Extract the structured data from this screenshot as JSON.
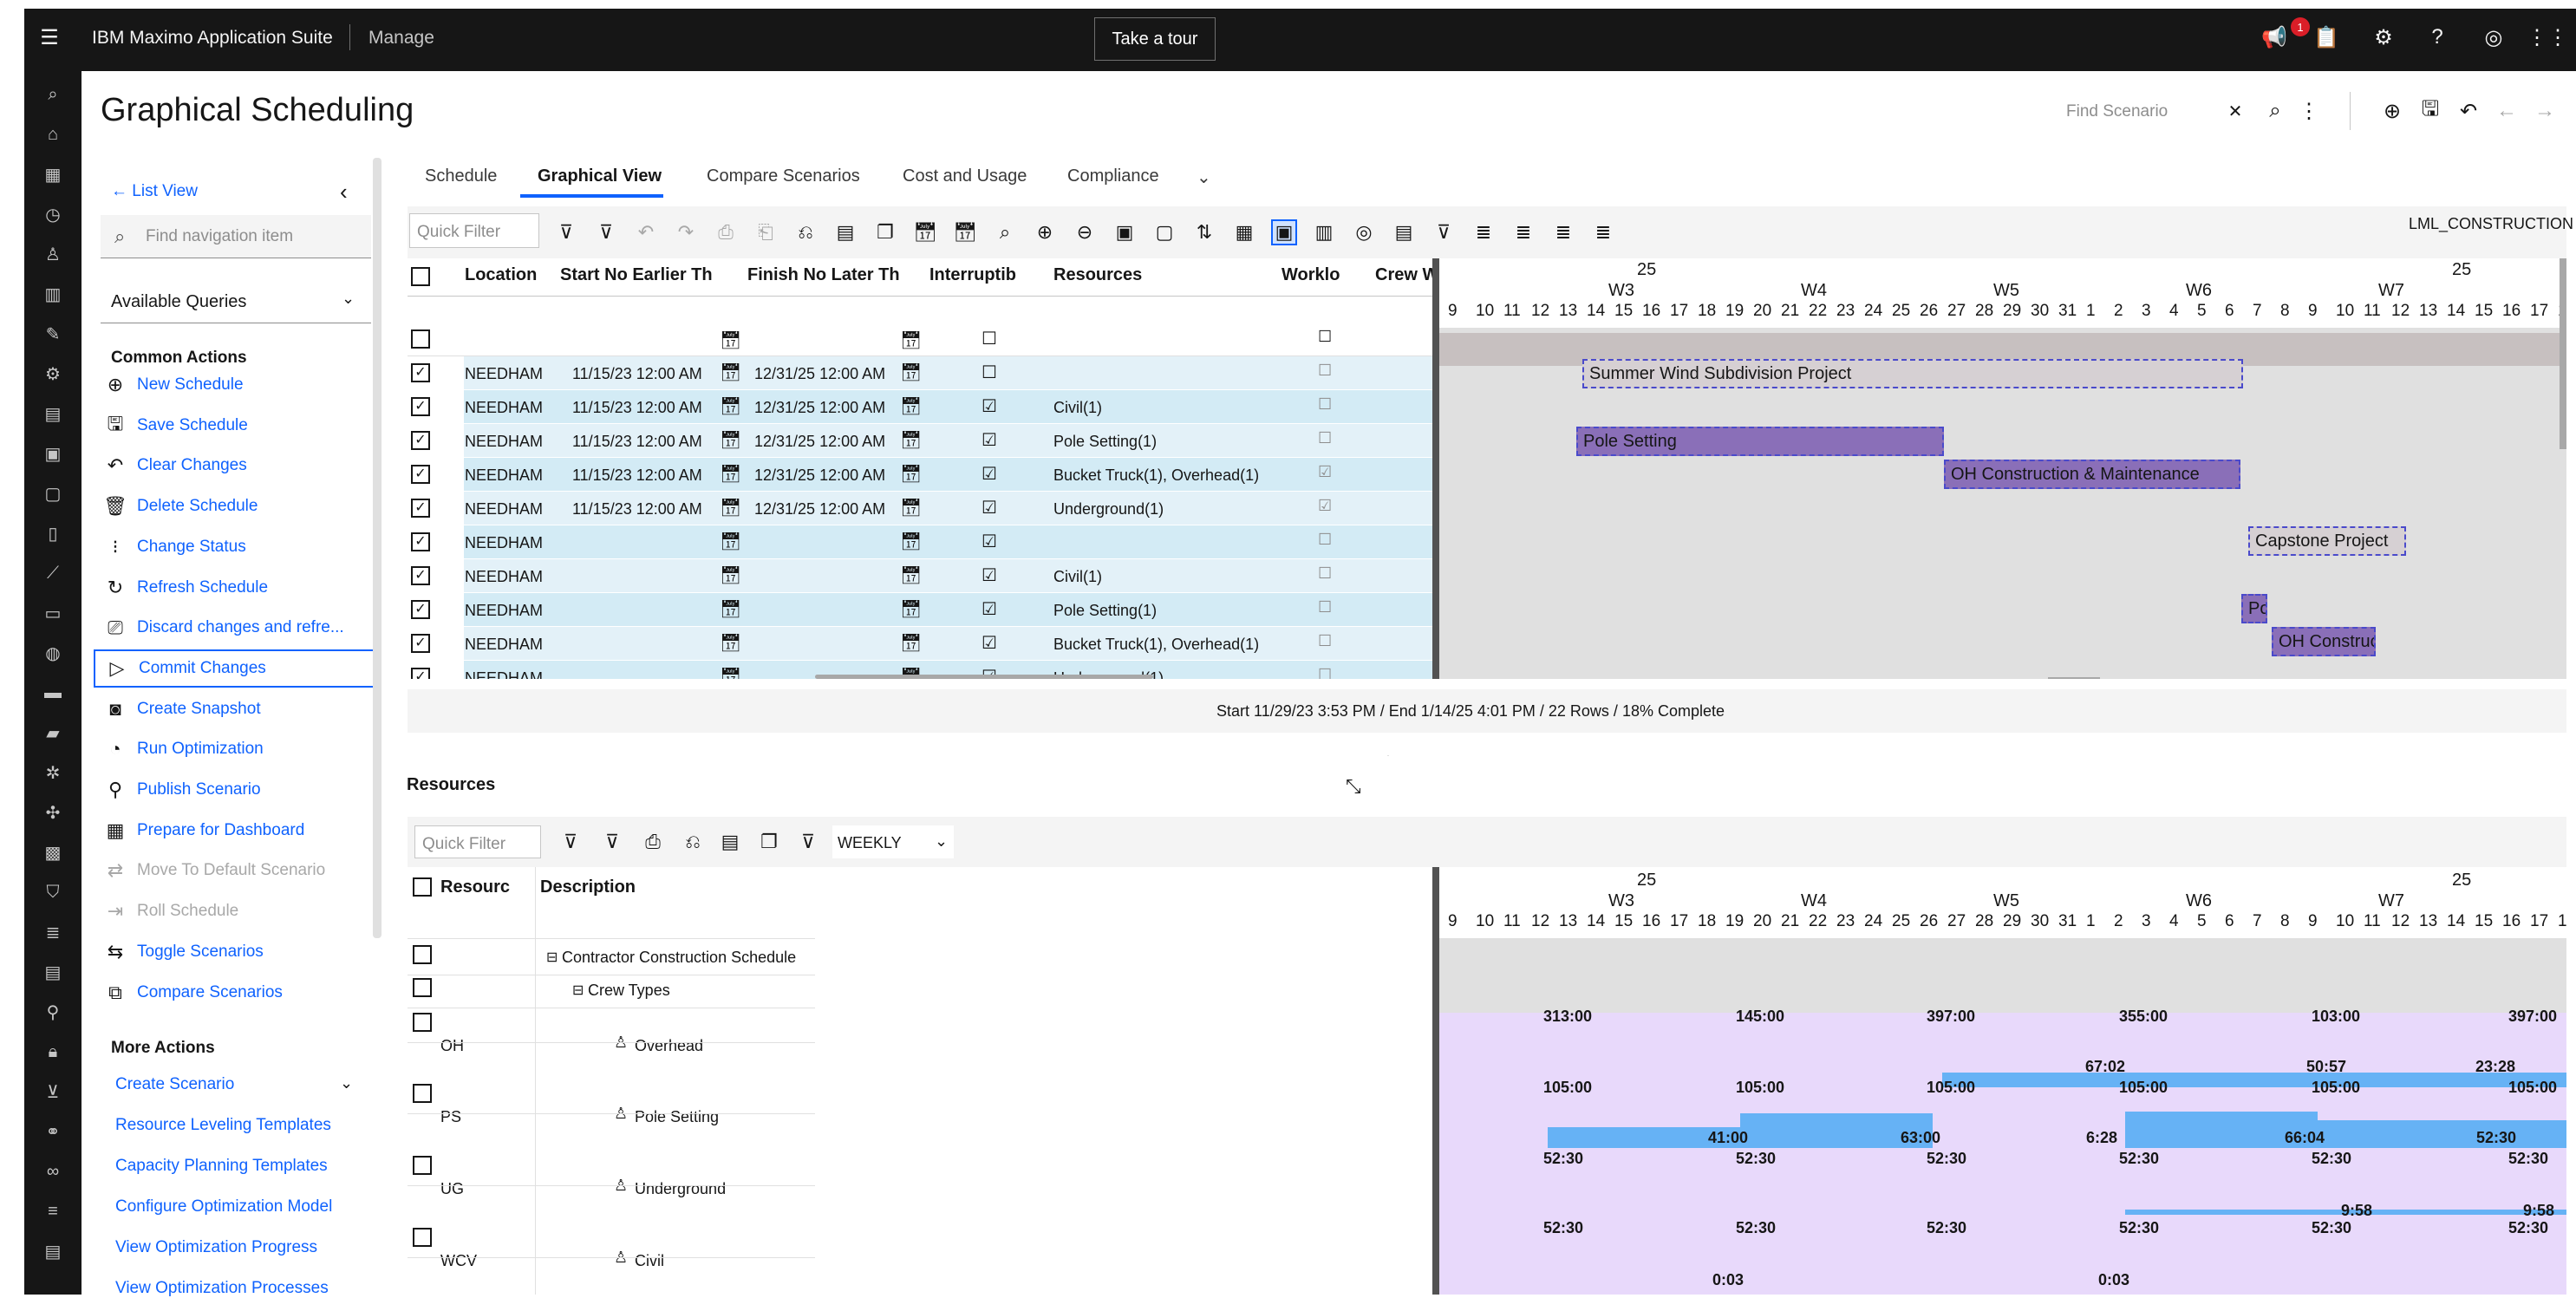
{
  "app": {
    "suite": "IBM Maximo Application Suite",
    "module": "Manage",
    "tour_label": "Take a tour",
    "notification_count": "1"
  },
  "page": {
    "title": "Graphical Scheduling",
    "find_scenario_placeholder": "Find Scenario"
  },
  "side_panel": {
    "back_label": "List View",
    "search_placeholder": "Find navigation item",
    "queries_label": "Available Queries",
    "common_actions_heading": "Common Actions",
    "common_actions": [
      {
        "label": "New Schedule",
        "icon": "plus-circle-icon"
      },
      {
        "label": "Save Schedule",
        "icon": "save-icon"
      },
      {
        "label": "Clear Changes",
        "icon": "undo-icon"
      },
      {
        "label": "Delete Schedule",
        "icon": "trash-icon"
      },
      {
        "label": "Change Status",
        "icon": "status-icon"
      },
      {
        "label": "Refresh Schedule",
        "icon": "refresh-icon"
      },
      {
        "label": "Discard changes and refre...",
        "icon": "discard-icon"
      },
      {
        "label": "Commit Changes",
        "icon": "send-icon"
      },
      {
        "label": "Create Snapshot",
        "icon": "camera-icon"
      },
      {
        "label": "Run Optimization",
        "icon": "optimize-icon"
      },
      {
        "label": "Publish Scenario",
        "icon": "publish-icon"
      },
      {
        "label": "Prepare for Dashboard",
        "icon": "dashboard-icon"
      },
      {
        "label": "Move To Default Scenario",
        "icon": "move-icon"
      },
      {
        "label": "Roll Schedule",
        "icon": "roll-icon"
      },
      {
        "label": "Toggle Scenarios",
        "icon": "toggle-icon"
      },
      {
        "label": "Compare Scenarios",
        "icon": "compare-icon"
      }
    ],
    "more_actions_heading": "More Actions",
    "more_actions": [
      "Create Scenario",
      "Resource Leveling Templates",
      "Capacity Planning Templates",
      "Configure Optimization Model",
      "View Optimization Progress",
      "View Optimization Processes"
    ]
  },
  "tabs": [
    "Schedule",
    "Graphical View",
    "Compare Scenarios",
    "Cost and Usage",
    "Compliance"
  ],
  "toolbar": {
    "quick_filter_placeholder": "Quick Filter",
    "project_label": "LML_CONSTRUCTION"
  },
  "grid": {
    "columns": [
      "Location",
      "Start No Earlier Th",
      "Finish No Later Th",
      "Interruptib",
      "Resources",
      "Worklo",
      "Crew W"
    ],
    "rows": [
      {
        "location": "NEEDHAM",
        "start": "11/15/23 12:00 AM",
        "finish": "12/31/25 12:00 AM",
        "interruptible": "☐",
        "resources": "",
        "workload": "☐"
      },
      {
        "location": "NEEDHAM",
        "start": "11/15/23 12:00 AM",
        "finish": "12/31/25 12:00 AM",
        "interruptible": "☑",
        "resources": "Civil(1)",
        "workload": "☐"
      },
      {
        "location": "NEEDHAM",
        "start": "11/15/23 12:00 AM",
        "finish": "12/31/25 12:00 AM",
        "interruptible": "☑",
        "resources": "Pole Setting(1)",
        "workload": "☐"
      },
      {
        "location": "NEEDHAM",
        "start": "11/15/23 12:00 AM",
        "finish": "12/31/25 12:00 AM",
        "interruptible": "☑",
        "resources": "Bucket Truck(1), Overhead(1)",
        "workload": "☑"
      },
      {
        "location": "NEEDHAM",
        "start": "11/15/23 12:00 AM",
        "finish": "12/31/25 12:00 AM",
        "interruptible": "☑",
        "resources": "Underground(1)",
        "workload": "☑"
      },
      {
        "location": "NEEDHAM",
        "start": "",
        "finish": "",
        "interruptible": "☑",
        "resources": "",
        "workload": "☐"
      },
      {
        "location": "NEEDHAM",
        "start": "",
        "finish": "",
        "interruptible": "☑",
        "resources": "Civil(1)",
        "workload": "☐"
      },
      {
        "location": "NEEDHAM",
        "start": "",
        "finish": "",
        "interruptible": "☑",
        "resources": "Pole Setting(1)",
        "workload": "☐"
      },
      {
        "location": "NEEDHAM",
        "start": "",
        "finish": "",
        "interruptible": "☑",
        "resources": "Bucket Truck(1), Overhead(1)",
        "workload": "☐"
      },
      {
        "location": "NEEDHAM",
        "start": "",
        "finish": "",
        "interruptible": "☑",
        "resources": "Underground(1)",
        "workload": "☐"
      }
    ]
  },
  "timeline": {
    "year_labels": [
      "25",
      "25"
    ],
    "weeks": [
      "W3",
      "W4",
      "W5",
      "W6",
      "W7"
    ],
    "days": [
      "9",
      "10",
      "11",
      "12",
      "13",
      "14",
      "15",
      "16",
      "17",
      "18",
      "19",
      "20",
      "21",
      "22",
      "23",
      "24",
      "25",
      "26",
      "27",
      "28",
      "29",
      "30",
      "31",
      "1",
      "2",
      "3",
      "4",
      "5",
      "6",
      "7",
      "8",
      "9",
      "10",
      "11",
      "12",
      "13",
      "14",
      "15",
      "16",
      "17",
      "1"
    ]
  },
  "gantt_bars": [
    {
      "label": "Summer Wind Subdivision Project"
    },
    {
      "label": "Pole Setting"
    },
    {
      "label": "OH Construction & Maintenance"
    },
    {
      "label": "Capstone Project"
    },
    {
      "label": "Po"
    },
    {
      "label": "OH Construct"
    }
  ],
  "status_text": "Start 11/29/23 3:53 PM / End 1/14/25 4:01 PM / 22 Rows / 18% Complete",
  "resources": {
    "title": "Resources",
    "quick_filter_placeholder": "Quick Filter",
    "period": "WEEKLY",
    "columns": [
      "Resourc",
      "Description"
    ],
    "tree": [
      {
        "code": "",
        "description": "Contractor Construction Schedule"
      },
      {
        "code": "",
        "description": "Crew Types"
      },
      {
        "code": "OH",
        "description": "Overhead"
      },
      {
        "code": "PS",
        "description": "Pole Setting"
      },
      {
        "code": "UG",
        "description": "Underground"
      },
      {
        "code": "WCV",
        "description": "Civil"
      }
    ]
  },
  "histogram": {
    "oh_capacity": [
      "313:00",
      "145:00",
      "397:00",
      "355:00",
      "103:00",
      "397:00"
    ],
    "oh_load": [
      "67:02",
      "50:57",
      "23:28"
    ],
    "ps_capacity": [
      "105:00",
      "105:00",
      "105:00",
      "105:00",
      "105:00",
      "105:00"
    ],
    "ps_load": [
      "41:00",
      "63:00",
      "6:28",
      "66:04",
      "52:30"
    ],
    "ug_capacity": [
      "52:30",
      "52:30",
      "52:30",
      "52:30",
      "52:30",
      "52:30"
    ],
    "ug_load": [
      "9:58",
      "9:58"
    ],
    "wcv_capacity": [
      "52:30",
      "52:30",
      "52:30",
      "52:30",
      "52:30",
      "52:30"
    ],
    "wcv_load": [
      "0:03",
      "0:03"
    ]
  },
  "colors": {
    "accent": "#0f62fe",
    "header_bg": "#161616",
    "bar_purple": "#8a6fb8",
    "histogram_lilac": "#e8d9fb",
    "load_blue": "#66b2f5"
  }
}
